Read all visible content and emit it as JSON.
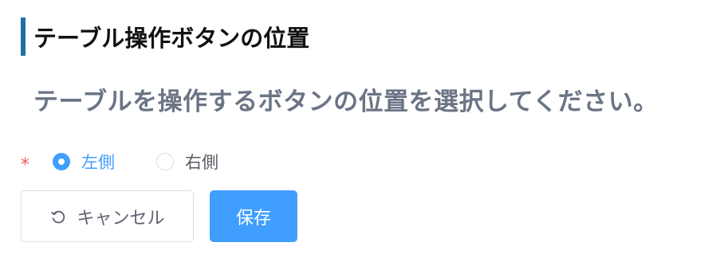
{
  "section": {
    "title": "テーブル操作ボタンの位置"
  },
  "question": {
    "text": "テーブルを操作するボタンの位置を選択してください。",
    "required_mark": "*"
  },
  "radio_options": [
    {
      "label": "左側",
      "checked": true
    },
    {
      "label": "右側",
      "checked": false
    }
  ],
  "buttons": {
    "cancel_label": "キャンセル",
    "cancel_icon": "refresh-icon",
    "save_label": "保存"
  },
  "colors": {
    "accent": "#409eff",
    "title_bar": "#1d6fa5",
    "required": "#f05a5a",
    "description": "#6b7485"
  }
}
